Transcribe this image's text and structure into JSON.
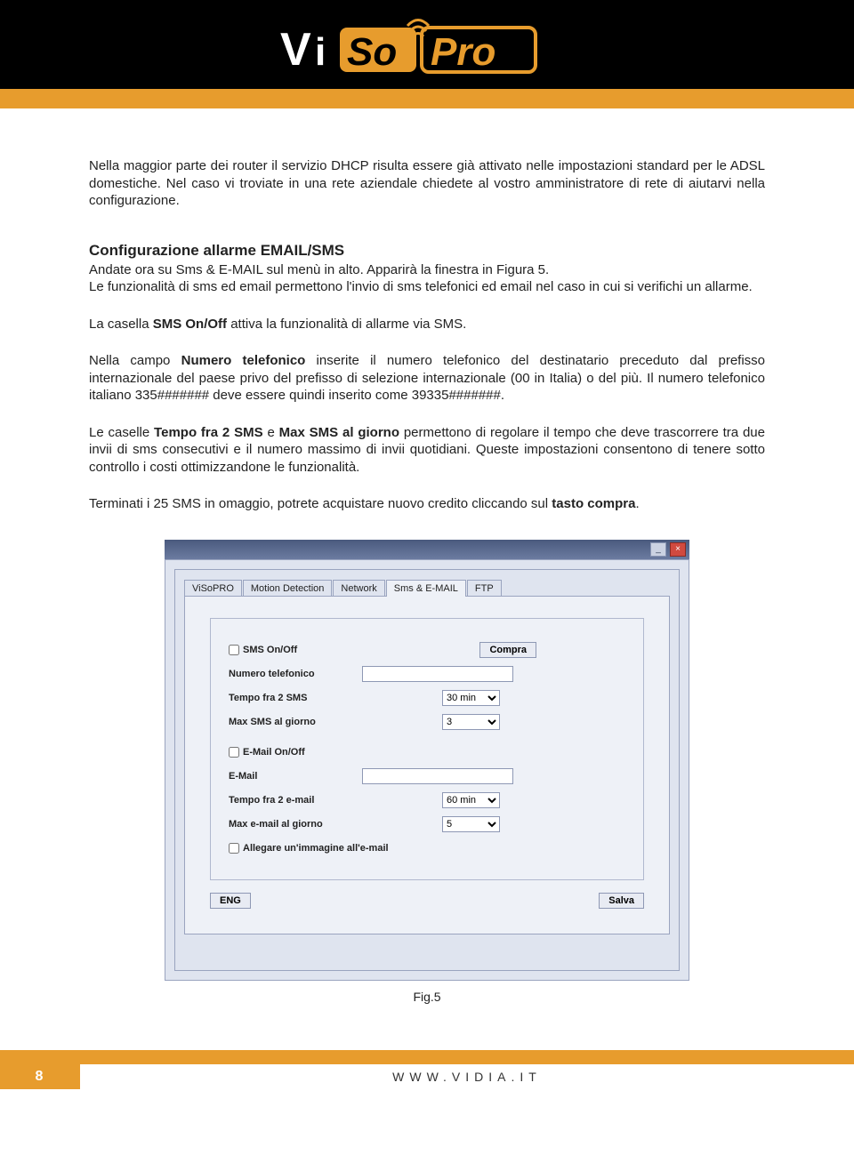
{
  "logo": {
    "vi": "Vi",
    "so": "So",
    "pro": "Pro"
  },
  "body": {
    "p1": "Nella maggior parte dei router il servizio DHCP risulta essere già attivato nelle impostazioni standard per le ADSL domestiche. Nel caso vi troviate in una rete aziendale chiedete al vostro amministratore di rete di aiutarvi nella configurazione.",
    "h1": "Configurazione allarme EMAIL/SMS",
    "p2": "Andate ora su Sms & E-MAIL sul menù in alto. Apparirà la finestra in Figura 5.",
    "p3": "Le funzionalità di sms ed email permettono l'invio di sms telefonici ed email nel caso in cui si verifichi un allarme.",
    "p4a": "La casella ",
    "p4b": "SMS On/Off",
    "p4c": " attiva la funzionalità di allarme via SMS.",
    "p5a": "Nella campo ",
    "p5b": "Numero telefonico",
    "p5c": " inserite il numero telefonico del destinatario preceduto dal prefisso internazionale del paese privo del prefisso di selezione internazionale (00 in Italia) o del più. Il numero telefonico italiano 335####### deve essere quindi inserito come 39335#######.",
    "p6a": "Le caselle ",
    "p6b": "Tempo fra 2 SMS",
    "p6c": " e ",
    "p6d": "Max SMS al giorno",
    "p6e": " permettono di regolare il tempo che deve trascorrere tra due invii di sms consecutivi e il numero massimo di invii quotidiani. Queste impostazioni consentono di tenere sotto controllo i costi ottimizzandone le funzionalità.",
    "p7a": "Terminati i 25 SMS in omaggio, potrete acquistare nuovo credito cliccando sul ",
    "p7b": "tasto compra",
    "p7c": "."
  },
  "window": {
    "tabs": [
      "ViSoPRO",
      "Motion Detection",
      "Network",
      "Sms & E-MAIL",
      "FTP"
    ],
    "active_tab": 3,
    "sms_onoff": "SMS On/Off",
    "compra": "Compra",
    "numero_tel": "Numero telefonico",
    "tempo_sms": "Tempo fra 2 SMS",
    "tempo_sms_val": "30 min",
    "max_sms": "Max SMS al giorno",
    "max_sms_val": "3",
    "email_onoff": "E-Mail On/Off",
    "email": "E-Mail",
    "tempo_email": "Tempo fra 2 e-mail",
    "tempo_email_val": "60 min",
    "max_email": "Max e-mail al giorno",
    "max_email_val": "5",
    "allegare": "Allegare un'immagine all'e-mail",
    "eng": "ENG",
    "salva": "Salva"
  },
  "fig_caption": "Fig.5",
  "footer": {
    "page": "8",
    "url": "WWW.VIDIA.IT"
  }
}
